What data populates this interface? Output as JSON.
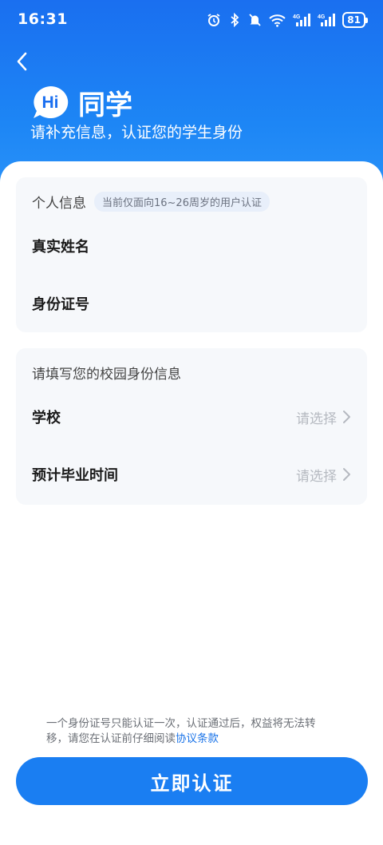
{
  "status_bar": {
    "time": "16:31",
    "battery": "81",
    "icons": [
      "alarm-icon",
      "bluetooth-icon",
      "mute-icon",
      "wifi-icon",
      "signal-4g-icon",
      "signal-4g-icon",
      "battery-icon"
    ],
    "net1": "4G",
    "net2": "4G"
  },
  "header": {
    "hi_badge": "Hi",
    "greeting": "同学",
    "subtitle": "请补充信息，认证您的学生身份"
  },
  "personal_card": {
    "title": "个人信息",
    "tag": "当前仅面向16~26周岁的用户认证",
    "name_label": "真实姓名",
    "id_label": "身份证号"
  },
  "campus_card": {
    "title": "请填写您的校园身份信息",
    "school_label": "学校",
    "school_placeholder": "请选择",
    "graduation_label": "预计毕业时间",
    "graduation_placeholder": "请选择"
  },
  "footer": {
    "notice_text": "一个身份证号只能认证一次，认证通过后，权益将无法转移，请您在认证前仔细阅读",
    "agreement_link": "协议条款",
    "submit_label": "立即认证"
  },
  "colors": {
    "brand_blue": "#1a7ef2",
    "link_blue": "#1a73e8"
  }
}
